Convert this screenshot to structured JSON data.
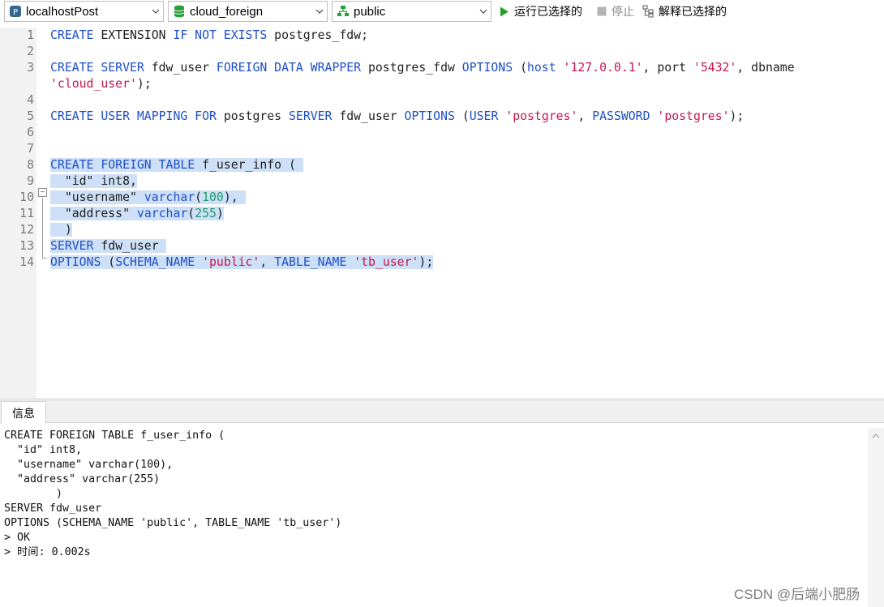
{
  "toolbar": {
    "connection": {
      "label": "localhostPost",
      "icon": "postgresql-elephant-icon"
    },
    "database": {
      "label": "cloud_foreign",
      "icon": "database-icon",
      "color": "#2a9d3c"
    },
    "schema": {
      "label": "public",
      "icon": "schema-icon",
      "color": "#2a9d3c"
    },
    "run_selected": "运行已选择的",
    "stop": "停止",
    "explain_selected": "解释已选择的"
  },
  "editor": {
    "line_numbers": [
      "1",
      "2",
      "3",
      "4",
      "5",
      "6",
      "7",
      "8",
      "9",
      "10",
      "11",
      "12",
      "13",
      "14"
    ],
    "lines": [
      {
        "n": 1,
        "tokens": [
          [
            "kw",
            "CREATE"
          ],
          [
            "t",
            " EXTENSION "
          ],
          [
            "kw",
            "IF NOT EXISTS"
          ],
          [
            "t",
            " postgres_fdw;"
          ]
        ]
      },
      {
        "n": 2,
        "tokens": []
      },
      {
        "n": 3,
        "tokens": [
          [
            "kw",
            "CREATE SERVER"
          ],
          [
            "t",
            " fdw_user "
          ],
          [
            "kw",
            "FOREIGN DATA WRAPPER"
          ],
          [
            "t",
            " postgres_fdw "
          ],
          [
            "kw",
            "OPTIONS"
          ],
          [
            "t",
            " ("
          ],
          [
            "kw",
            "host"
          ],
          [
            "t",
            " "
          ],
          [
            "str",
            "'127.0.0.1'"
          ],
          [
            "t",
            ", port "
          ],
          [
            "str",
            "'5432'"
          ],
          [
            "t",
            ", dbname"
          ]
        ]
      },
      {
        "n": 0,
        "tokens": [
          [
            "str",
            "'cloud_user'"
          ],
          [
            "t",
            ");"
          ]
        ]
      },
      {
        "n": 4,
        "tokens": []
      },
      {
        "n": 5,
        "tokens": [
          [
            "kw",
            "CREATE USER MAPPING FOR"
          ],
          [
            "t",
            " postgres "
          ],
          [
            "kw",
            "SERVER"
          ],
          [
            "t",
            " fdw_user "
          ],
          [
            "kw",
            "OPTIONS"
          ],
          [
            "t",
            " ("
          ],
          [
            "kw",
            "USER"
          ],
          [
            "t",
            " "
          ],
          [
            "str",
            "'postgres'"
          ],
          [
            "t",
            ", "
          ],
          [
            "kw",
            "PASSWORD"
          ],
          [
            "t",
            " "
          ],
          [
            "str",
            "'postgres'"
          ],
          [
            "t",
            ");"
          ]
        ]
      },
      {
        "n": 6,
        "tokens": []
      },
      {
        "n": 7,
        "tokens": []
      },
      {
        "n": 8,
        "sel": true,
        "tokens": [
          [
            "kw",
            "CREATE FOREIGN TABLE"
          ],
          [
            "t",
            " f_user_info ( "
          ]
        ]
      },
      {
        "n": 9,
        "sel": true,
        "tokens": [
          [
            "t",
            "  \"id\" int8,"
          ]
        ]
      },
      {
        "n": 10,
        "sel": true,
        "tokens": [
          [
            "t",
            "  \"username\" "
          ],
          [
            "kw",
            "varchar"
          ],
          [
            "t",
            "("
          ],
          [
            "num",
            "100"
          ],
          [
            "t",
            "), "
          ]
        ]
      },
      {
        "n": 11,
        "sel": true,
        "tokens": [
          [
            "t",
            "  \"address\" "
          ],
          [
            "kw",
            "varchar"
          ],
          [
            "t",
            "("
          ],
          [
            "num",
            "255"
          ],
          [
            "t",
            ")"
          ]
        ]
      },
      {
        "n": 12,
        "sel": true,
        "tokens": [
          [
            "t",
            "  )"
          ]
        ]
      },
      {
        "n": 13,
        "sel": true,
        "tokens": [
          [
            "kw",
            "SERVER"
          ],
          [
            "t",
            " fdw_user "
          ]
        ]
      },
      {
        "n": 14,
        "sel": true,
        "tokens": [
          [
            "kw",
            "OPTIONS"
          ],
          [
            "t",
            " ("
          ],
          [
            "kw",
            "SCHEMA_NAME"
          ],
          [
            "t",
            " "
          ],
          [
            "str",
            "'public'"
          ],
          [
            "t",
            ", "
          ],
          [
            "kw",
            "TABLE_NAME"
          ],
          [
            "t",
            " "
          ],
          [
            "str",
            "'tb_user'"
          ],
          [
            "t",
            ");"
          ]
        ]
      }
    ]
  },
  "result": {
    "tab_label": "信息",
    "lines": [
      "CREATE FOREIGN TABLE f_user_info (",
      "  \"id\" int8,",
      "  \"username\" varchar(100),",
      "  \"address\" varchar(255)",
      "        )",
      "SERVER fdw_user",
      "OPTIONS (SCHEMA_NAME 'public', TABLE_NAME 'tb_user')",
      "> OK",
      "> 时间: 0.002s"
    ]
  },
  "watermark": "CSDN @后端小肥肠"
}
